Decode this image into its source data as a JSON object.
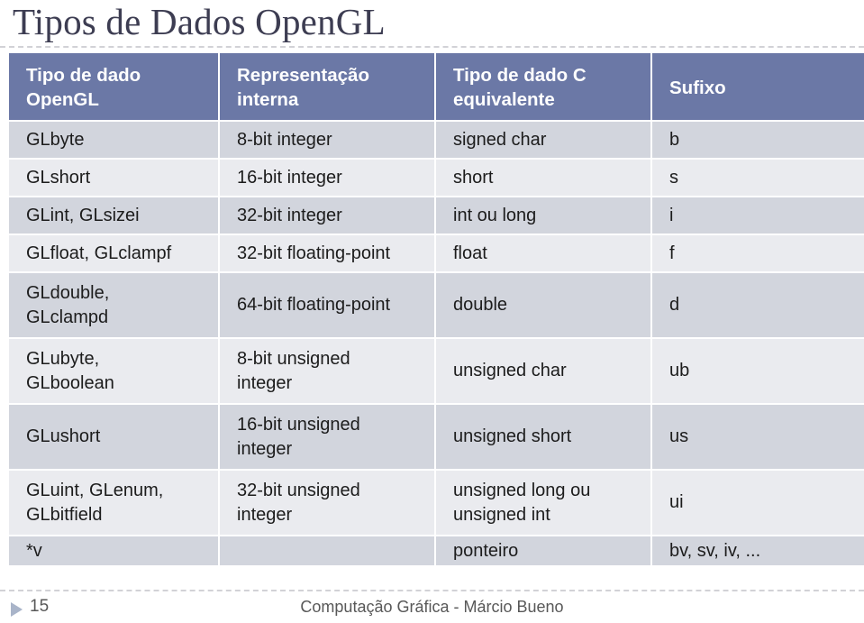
{
  "slide": {
    "title": "Tipos de Dados OpenGL",
    "number": "15",
    "footer_text": "Computação Gráfica - Márcio Bueno",
    "footer_bullet_icon": "triangle-right-icon"
  },
  "colors": {
    "header_background": "#6b78a6",
    "header_text": "#ffffff",
    "row_dark": "#d2d5dd",
    "row_light": "#eaebef",
    "title_text": "#3d3d52",
    "footer_text": "#585858",
    "rule": "#d2d2d6",
    "footer_bullet": "#a9b4c9"
  },
  "table": {
    "headers": [
      {
        "line1": "Tipo de dado",
        "line2": "OpenGL"
      },
      {
        "line1": "Representação",
        "line2": "interna"
      },
      {
        "line1": "Tipo de dado C",
        "line2": "equivalente"
      },
      {
        "line1": "Sufixo",
        "line2": ""
      }
    ],
    "rows": [
      {
        "opengl_type_line1": "GLbyte",
        "opengl_type_line2": "",
        "internal_line1": "8-bit integer",
        "internal_line2": "",
        "c_type_line1": "signed char",
        "c_type_line2": "",
        "suffix": "b"
      },
      {
        "opengl_type_line1": "GLshort",
        "opengl_type_line2": "",
        "internal_line1": "16-bit integer",
        "internal_line2": "",
        "c_type_line1": "short",
        "c_type_line2": "",
        "suffix": "s"
      },
      {
        "opengl_type_line1": "GLint, GLsizei",
        "opengl_type_line2": "",
        "internal_line1": "32-bit integer",
        "internal_line2": "",
        "c_type_line1": "int ou long",
        "c_type_line2": "",
        "suffix": "i"
      },
      {
        "opengl_type_line1": "GLfloat, GLclampf",
        "opengl_type_line2": "",
        "internal_line1": "32-bit floating-point",
        "internal_line2": "",
        "c_type_line1": "float",
        "c_type_line2": "",
        "suffix": "f"
      },
      {
        "opengl_type_line1": "GLdouble,",
        "opengl_type_line2": "GLclampd",
        "internal_line1": "64-bit floating-point",
        "internal_line2": "",
        "c_type_line1": "double",
        "c_type_line2": "",
        "suffix": "d"
      },
      {
        "opengl_type_line1": "GLubyte,",
        "opengl_type_line2": "GLboolean",
        "internal_line1": "8-bit unsigned",
        "internal_line2": "integer",
        "c_type_line1": "unsigned char",
        "c_type_line2": "",
        "suffix": "ub"
      },
      {
        "opengl_type_line1": "GLushort",
        "opengl_type_line2": "",
        "internal_line1": "16-bit unsigned",
        "internal_line2": "integer",
        "c_type_line1": "unsigned short",
        "c_type_line2": "",
        "suffix": "us"
      },
      {
        "opengl_type_line1": "GLuint, GLenum,",
        "opengl_type_line2": "GLbitfield",
        "internal_line1": "32-bit unsigned",
        "internal_line2": "integer",
        "c_type_line1": "unsigned long ou",
        "c_type_line2": "unsigned int",
        "suffix": "ui"
      },
      {
        "opengl_type_line1": "*v",
        "opengl_type_line2": "",
        "internal_line1": "",
        "internal_line2": "",
        "c_type_line1": "ponteiro",
        "c_type_line2": "",
        "suffix": "bv, sv, iv, ..."
      }
    ]
  }
}
